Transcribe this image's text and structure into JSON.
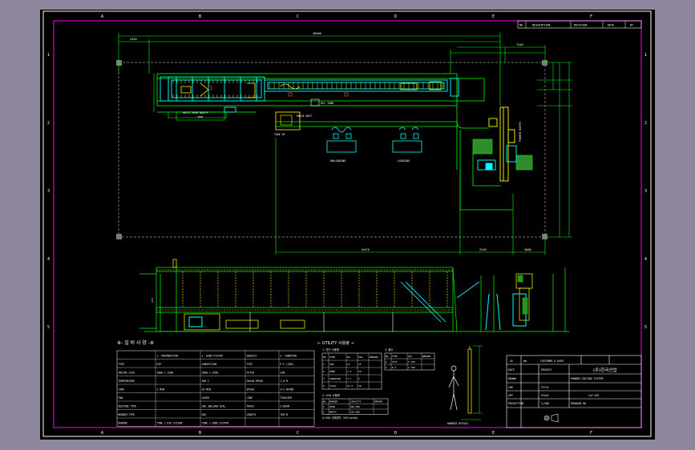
{
  "drawing": {
    "grid": {
      "columns": [
        "A",
        "B",
        "C",
        "D",
        "E",
        "F"
      ],
      "rows": [
        "1",
        "2",
        "3",
        "4",
        "5"
      ]
    },
    "rev_table": [
      "NO",
      "DESCRIPTION",
      "REVISION",
      "DATE",
      "BY"
    ],
    "plan_labels": {
      "dim_overall": "36000",
      "dim_left": "4340",
      "dim_right": "7340",
      "dim_bottom_a": "14470",
      "dim_bottom_b": "2240",
      "dim_bottom_c": "3000",
      "hoist": "HOIST ROOM BOOTH",
      "hoist_dim": "4000",
      "oil_tank": "OIL TANK",
      "drive": "DRIVE UNIT",
      "take_up": "TAKE UP",
      "unloading": "UNLOADING",
      "loading": "LOADING",
      "powder_booth": "POWDER BOOTH"
    },
    "spec": {
      "title": "※- 설 비 사 양 -※",
      "headers": [
        "",
        "1. PREPARATION",
        "2. OVEN SYSTEM",
        "SUBJECT",
        "3. CONVEYOR"
      ],
      "rows": [
        [
          "TYPE",
          "DIP",
          "CONVECTION",
          "TYPE",
          "P.F.(3IN)"
        ],
        [
          "INSIDE SIZE",
          "2000 x 1500",
          "2000 x 1500",
          "PITCH",
          "3IN"
        ],
        [
          "TEMPERATURE",
          "-",
          "180 C",
          "CHAIN SPEED",
          "1.0 M"
        ],
        [
          "TIME",
          "2 MIN",
          "20 MIN",
          "SPEED",
          "3~5 M/MIN"
        ],
        [
          "FAN",
          "-",
          "LAVER",
          "LINE",
          "STRAIGHT"
        ],
        [
          "HEATING TYPE",
          "-",
          "LNG 300,000 KCAL",
          "TRACK",
          "I-BEAM"
        ],
        [
          "BURNER TYPE",
          "-",
          "GAS",
          "LENGTH",
          "150 M"
        ],
        [
          "REMARK",
          "TIME / DIP SYSTEM",
          "TIME / CONV SYSTEM",
          "",
          ""
        ]
      ]
    },
    "utility": {
      "title": "← UTILITY 사용량 →",
      "elec_title": "1. 전기 사용량",
      "elec_headers": [
        "NO",
        "ITEM",
        "KW",
        "KVA",
        "REMARK"
      ],
      "elec_rows": [
        [
          "1",
          "FAN",
          "11",
          "15",
          ""
        ],
        [
          "2",
          "PUMP",
          "7.5",
          "10",
          ""
        ],
        [
          "3",
          "CONVEYOR",
          "3.7",
          "5",
          ""
        ],
        [
          "4",
          "TOTAL",
          "22.2",
          "30",
          ""
        ]
      ],
      "lng_title": "2. LNG 사용량",
      "lng_headers": [
        "NO",
        "BURNER",
        "CAPACITY",
        "REMARK"
      ],
      "lng_rows": [
        [
          "1",
          "OVEN",
          "300,000",
          ""
        ],
        [
          "2",
          "BOOTH",
          "150,000",
          ""
        ]
      ],
      "lng_note": "※ LNG 사용압력 : 200 mmAq",
      "water_title": "3. 용수",
      "water_headers": [
        "NO",
        "TYPE",
        "QTY",
        "REMARK"
      ],
      "water_rows": [
        [
          "1",
          "CITY",
          "5 TON",
          ""
        ],
        [
          "2",
          "D.I.",
          "2 TON",
          ""
        ]
      ]
    },
    "hanger_label": "HANGER DETAIL",
    "title_block": {
      "customer": "CUSTOMER & USER",
      "company": "(주)한국산업",
      "project_label": "PROJECT",
      "project": "POWDER COATING SYSTEM",
      "title_label": "TITLE",
      "title": "LAY-OUT",
      "scale_label": "SCALE",
      "scale": "1/100",
      "drawing_no_label": "DRAWING NO",
      "date_label": "DATE",
      "drawn_label": "DRAWN",
      "checked_label": "CHK",
      "approved_label": "APP",
      "projection_label": "PROJECTION",
      "sheet": "A3",
      "unit": "mm"
    }
  },
  "colors": {
    "background": "#000000",
    "border": "#ffffff",
    "frame": "#ff00ff",
    "dim": "#00ff00",
    "cyan": "#00ffff",
    "yellow": "#ffff00",
    "white": "#ffffff",
    "grey": "#9a9a9a"
  }
}
